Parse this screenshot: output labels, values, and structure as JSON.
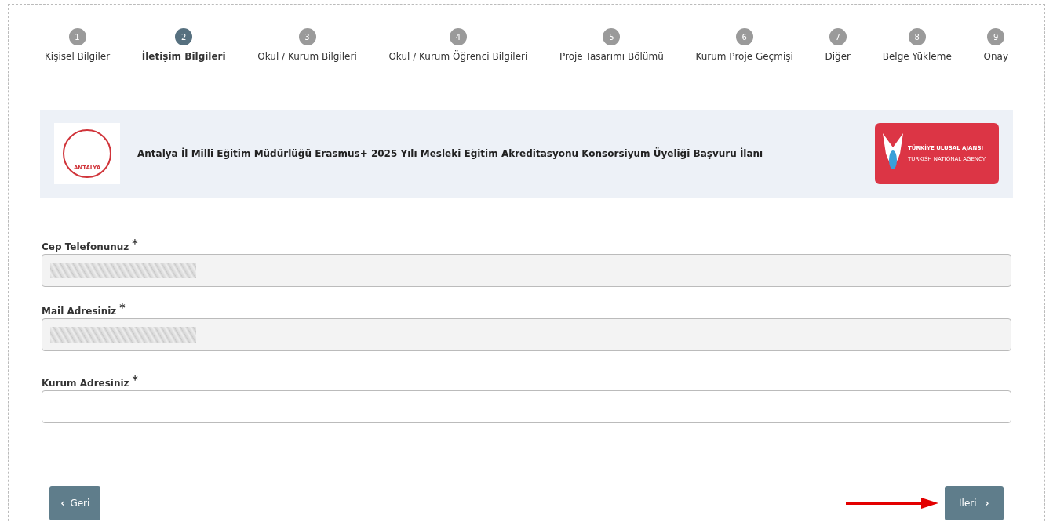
{
  "steps": [
    {
      "number": "1",
      "label": "Kişisel Bilgiler",
      "selected": false
    },
    {
      "number": "2",
      "label": "İletişim Bilgileri",
      "selected": true
    },
    {
      "number": "3",
      "label": "Okul / Kurum Bilgileri",
      "selected": false
    },
    {
      "number": "4",
      "label": "Okul / Kurum Öğrenci Bilgileri",
      "selected": false
    },
    {
      "number": "5",
      "label": "Proje Tasarımı Bölümü",
      "selected": false
    },
    {
      "number": "6",
      "label": "Kurum Proje Geçmişi",
      "selected": false
    },
    {
      "number": "7",
      "label": "Diğer",
      "selected": false
    },
    {
      "number": "8",
      "label": "Belge Yükleme",
      "selected": false
    },
    {
      "number": "9",
      "label": "Onay",
      "selected": false
    }
  ],
  "banner": {
    "left_logo_text": "ANTALYA",
    "title": "Antalya İl Milli Eğitim Müdürlüğü Erasmus+ 2025 Yılı Mesleki Eğitim Akreditasyonu Konsorsiyum Üyeliği Başvuru İlanı",
    "right_logo_title": "TÜRKİYE ULUSAL AJANSI",
    "right_logo_subtitle": "TURKISH NATIONAL AGENCY"
  },
  "fields": [
    {
      "label": "Cep Telefonunuz",
      "required": "*",
      "disabled": true,
      "redacted": true
    },
    {
      "label": "Mail Adresiniz",
      "required": "*",
      "disabled": true,
      "redacted": true
    },
    {
      "label": "Kurum Adresiniz",
      "required": "*",
      "disabled": false,
      "redacted": false
    }
  ],
  "back_button": {
    "icon": "‹",
    "label": "Geri"
  },
  "next_button": {
    "label": "İleri",
    "icon": "›"
  }
}
